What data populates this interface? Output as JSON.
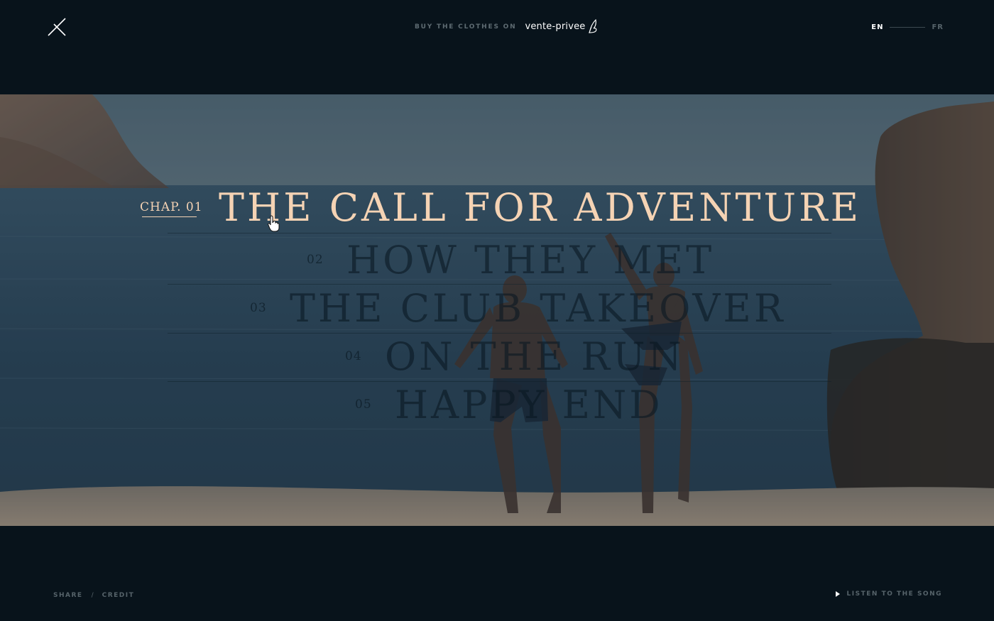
{
  "header": {
    "buy_label": "BUY THE CLOTHES ON",
    "brand": "vente-privee",
    "close_icon": "close-x-icon",
    "languages": [
      {
        "code": "EN",
        "active": true
      },
      {
        "code": "FR",
        "active": false
      }
    ]
  },
  "chapters": [
    {
      "number": "CHAP. 01",
      "title": "THE CALL FOR ADVENTURE",
      "active": true
    },
    {
      "number": "02",
      "title": "HOW THEY MET",
      "active": false
    },
    {
      "number": "03",
      "title": "THE CLUB TAKEOVER",
      "active": false
    },
    {
      "number": "04",
      "title": "ON THE RUN",
      "active": false
    },
    {
      "number": "05",
      "title": "HAPPY END",
      "active": false
    }
  ],
  "footer": {
    "share": "SHARE",
    "separator": "/",
    "credit": "CREDIT",
    "listen": "LISTEN TO THE SONG",
    "play_icon": "play-icon"
  },
  "colors": {
    "background": "#08131b",
    "accent": "#f5d3b4",
    "muted": "#56636a"
  }
}
